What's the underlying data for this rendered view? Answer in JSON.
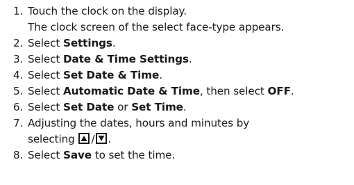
{
  "steps": [
    {
      "number": "1.",
      "lines": [
        "Touch the clock on the display.",
        "The clock screen of the select face-type appears."
      ]
    },
    {
      "number": "2.",
      "pre": "Select ",
      "bold": "Settings",
      "post": "."
    },
    {
      "number": "3.",
      "pre": "Select ",
      "bold": "Date & Time Settings",
      "post": "."
    },
    {
      "number": "4.",
      "pre": "Select ",
      "bold": "Set Date & Time",
      "post": "."
    },
    {
      "number": "5.",
      "pre": "Select ",
      "bold": "Automatic Date & Time",
      "mid": ", then select ",
      "bold2": "OFF",
      "post": "."
    },
    {
      "number": "6.",
      "pre": "Select ",
      "bold": "Set Date",
      "mid": " or ",
      "bold2": "Set Time",
      "post": "."
    },
    {
      "number": "7.",
      "line1": "Adjusting the dates, hours and minutes by",
      "line2_pre": "selecting ",
      "slash": "/",
      "post": ".",
      "icons": [
        "up-arrow-icon",
        "down-arrow-icon"
      ]
    },
    {
      "number": "8.",
      "pre": "Select ",
      "bold": "Save",
      "post": " to set the time."
    }
  ]
}
